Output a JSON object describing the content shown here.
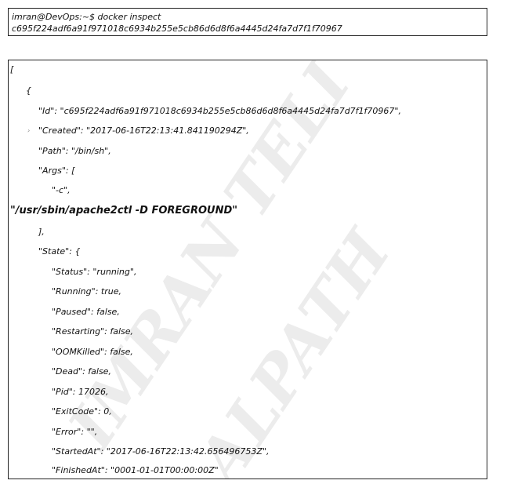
{
  "terminal": {
    "prompt_line": "imran@DevOps:~$ docker inspect",
    "container_id_line": "c695f224adf6a91f971018c6934b255e5cb86d6d8f6a4445d24fa7d7f1f70967"
  },
  "output": {
    "open_bracket": "[",
    "open_brace": "{",
    "id_line": "\"Id\": \"c695f224adf6a91f971018c6934b255e5cb86d6d8f6a4445d24fa7d7f1f70967\",",
    "created_line": "\"Created\": \"2017-06-16T22:13:41.841190294Z\",",
    "path_line": "\"Path\": \"/bin/sh\",",
    "args_line": "\"Args\": [",
    "arg_c_line": "\"-c\",",
    "arg_cmd_line": "\"/usr/sbin/apache2ctl -D FOREGROUND\"",
    "args_close_line": "],",
    "state_line": "\"State\": {",
    "status_line": "\"Status\": \"running\",",
    "running_line": "\"Running\": true,",
    "paused_line": "\"Paused\": false,",
    "restarting_line": "\"Restarting\": false,",
    "oomkilled_line": "\"OOMKilled\": false,",
    "dead_line": "\"Dead\": false,",
    "pid_line": "\"Pid\": 17026,",
    "exitcode_line": "\"ExitCode\": 0,",
    "error_line": "\"Error\": \"\",",
    "startedat_line": "\"StartedAt\": \"2017-06-16T22:13:42.656496753Z\",",
    "finishedat_line": "\"FinishedAt\": \"0001-01-01T00:00:00Z\""
  },
  "watermark": {
    "line1": "IMRAN TELI",
    "line2": "ALPATH"
  },
  "colors": {
    "text": "#111111",
    "border": "#222222",
    "watermark": "#ececec"
  }
}
